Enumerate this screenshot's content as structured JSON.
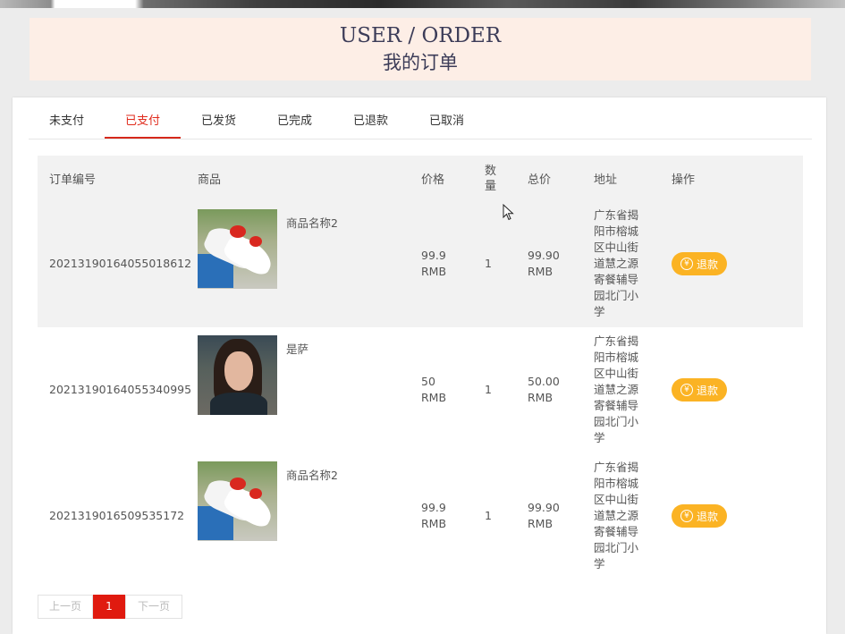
{
  "banner": {
    "title_en": "USER / ORDER",
    "title_cn": "我的订单"
  },
  "tabs": [
    {
      "label": "未支付",
      "active": false
    },
    {
      "label": "已支付",
      "active": true
    },
    {
      "label": "已发货",
      "active": false
    },
    {
      "label": "已完成",
      "active": false
    },
    {
      "label": "已退款",
      "active": false
    },
    {
      "label": "已取消",
      "active": false
    }
  ],
  "table": {
    "headers": {
      "order_no": "订单编号",
      "product": "商品",
      "price": "价格",
      "qty": "数量",
      "total": "总价",
      "address": "地址",
      "action": "操作"
    },
    "rows": [
      {
        "order_no": "20213190164055018612",
        "product_name": "商品名称2",
        "image_icon": "shoe-image",
        "price": "99.9 RMB",
        "qty": "1",
        "total": "99.90 RMB",
        "address": "广东省揭阳市榕城区中山街道慧之源寄餐辅导园北门小学",
        "action_label": "退款"
      },
      {
        "order_no": "20213190164055340995",
        "product_name": "是萨",
        "image_icon": "portrait-image",
        "price": "50 RMB",
        "qty": "1",
        "total": "50.00 RMB",
        "address": "广东省揭阳市榕城区中山街道慧之源寄餐辅导园北门小学",
        "action_label": "退款"
      },
      {
        "order_no": "2021319016509535172",
        "product_name": "商品名称2",
        "image_icon": "shoe-image",
        "price": "99.9 RMB",
        "qty": "1",
        "total": "99.90 RMB",
        "address": "广东省揭阳市榕城区中山街道慧之源寄餐辅导园北门小学",
        "action_label": "退款"
      }
    ]
  },
  "pager": {
    "prev": "上一页",
    "current": "1",
    "next": "下一页"
  },
  "colors": {
    "accent": "#e01a0f",
    "refund": "#fbb324",
    "banner_bg": "#fdeee6"
  }
}
